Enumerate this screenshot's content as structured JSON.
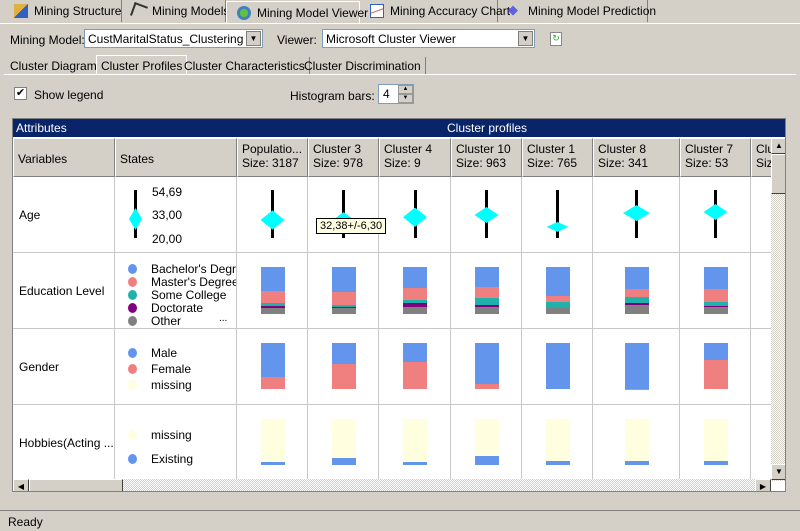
{
  "top_tabs": [
    "Mining Structure",
    "Mining Models",
    "Mining Model Viewer",
    "Mining Accuracy Chart",
    "Mining Model Prediction"
  ],
  "active_top_tab": 2,
  "mining_model": {
    "label": "Mining Model:",
    "value": "CustMaritalStatus_Clustering"
  },
  "viewer": {
    "label": "Viewer:",
    "value": "Microsoft Cluster Viewer"
  },
  "sub_tabs": [
    "Cluster Diagram",
    "Cluster Profiles",
    "Cluster Characteristics",
    "Cluster Discrimination"
  ],
  "active_sub_tab": 1,
  "show_legend": {
    "label": "Show legend",
    "checked": true
  },
  "histogram_bars": {
    "label": "Histogram bars:",
    "value": "4"
  },
  "grid": {
    "attributes_label": "Attributes",
    "profiles_label": "Cluster profiles",
    "variables_header": "Variables",
    "states_header": "States"
  },
  "colors": {
    "Bachelor's Degr": "#6495ed",
    "Master's Degree": "#f08080",
    "Some College": "#20b2aa",
    "Doctorate": "#800080",
    "Other": "#808080",
    "Male": "#6495ed",
    "Female": "#f08080",
    "missing": "#ffffe0",
    "Existing": "#6495ed",
    "diamond": "#00ffff"
  },
  "variables": [
    {
      "name": "Age",
      "type": "continuous",
      "max": "54,69",
      "mean": "33,00",
      "min": "20,00",
      "range": [
        20,
        54.69
      ]
    },
    {
      "name": "Education Level",
      "states": [
        "Bachelor's Degr",
        "Master's Degree",
        "Some College",
        "Doctorate",
        "Other"
      ],
      "more": "..."
    },
    {
      "name": "Gender",
      "states": [
        "Male",
        "Female",
        "missing"
      ]
    },
    {
      "name": "Hobbies(Acting ...",
      "states": [
        "missing",
        "Existing"
      ]
    }
  ],
  "clusters": [
    {
      "name": "Populatio...",
      "size": "Size: 3187",
      "age": {
        "mean": 33.0,
        "sd": 7
      },
      "edu": [
        0.51,
        0.26,
        0.06,
        0.04,
        0.13
      ],
      "gender": [
        0.73,
        0.27,
        0
      ],
      "hobbies": [
        0.94,
        0.06
      ]
    },
    {
      "name": "Cluster 3",
      "size": "Size: 978",
      "age": {
        "mean": 32.38,
        "sd": 6.3
      },
      "edu": [
        0.53,
        0.27,
        0.06,
        0.02,
        0.12
      ],
      "gender": [
        0.46,
        0.54,
        0
      ],
      "hobbies": [
        0.84,
        0.16
      ]
    },
    {
      "name": "Cluster 4",
      "size": "Size: 9",
      "age": {
        "mean": 35,
        "sd": 7
      },
      "edu": [
        0.44,
        0.26,
        0.06,
        0.09,
        0.15
      ],
      "gender": [
        0.41,
        0.59,
        0
      ],
      "hobbies": [
        0.94,
        0.06
      ]
    },
    {
      "name": "Cluster 10",
      "size": "Size: 963",
      "age": {
        "mean": 36.6,
        "sd": 5.8
      },
      "edu": [
        0.42,
        0.25,
        0.13,
        0.05,
        0.15
      ],
      "gender": [
        0.89,
        0.11,
        0
      ],
      "hobbies": [
        0.81,
        0.19
      ]
    },
    {
      "name": "Cluster 1",
      "size": "Size: 765",
      "age": {
        "mean": 28,
        "sd": 3.6
      },
      "edu": [
        0.61,
        0.13,
        0.13,
        0,
        0.13
      ],
      "gender": [
        1,
        0,
        0
      ],
      "hobbies": [
        0.92,
        0.08
      ]
    },
    {
      "name": "Cluster 8",
      "size": "Size: 341",
      "age": {
        "mean": 38,
        "sd": 5.8
      },
      "edu": [
        0.47,
        0.16,
        0.14,
        0.03,
        0.2
      ],
      "gender": [
        0.99,
        0.01,
        0
      ],
      "hobbies": [
        0.92,
        0.08
      ]
    },
    {
      "name": "Cluster 7",
      "size": "Size: 53",
      "age": {
        "mean": 38.8,
        "sd": 5.8
      },
      "edu": [
        0.47,
        0.27,
        0.09,
        0.02,
        0.15
      ],
      "gender": [
        0.37,
        0.63,
        0
      ],
      "hobbies": [
        0.92,
        0.08
      ]
    },
    {
      "name": "Clu...",
      "size": "Size..."
    }
  ],
  "tooltip": "32,38+/-6,30",
  "status": "Ready"
}
